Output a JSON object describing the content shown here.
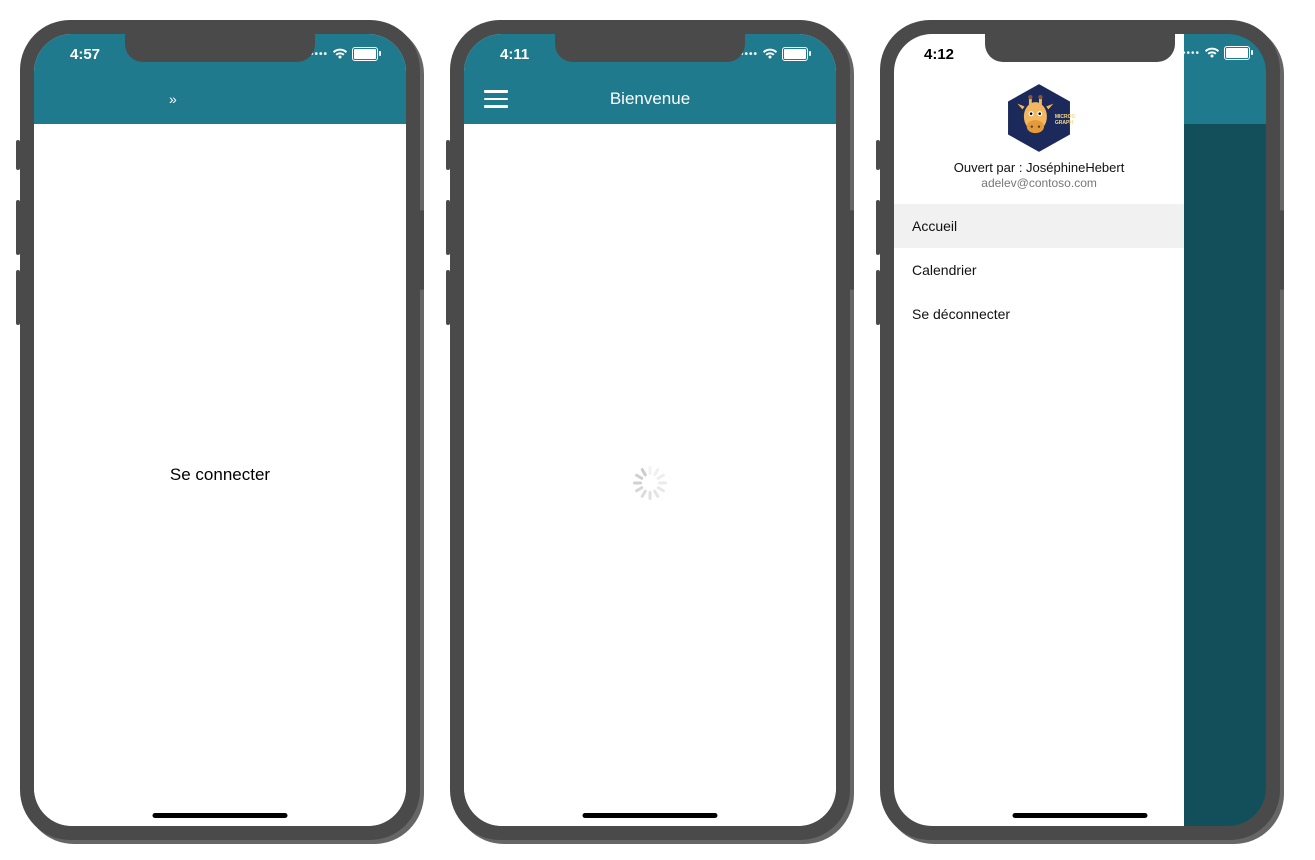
{
  "colors": {
    "teal": "#1e7a8c"
  },
  "phone1": {
    "time": "4:57",
    "signin_label": "Se connecter",
    "nav_glyph": "»"
  },
  "phone2": {
    "time": "4:11",
    "title": "Bienvenue"
  },
  "phone3": {
    "time": "4:12",
    "user_prefix": "Ouvert par : ",
    "user_name": "JoséphineHebert",
    "user_email": "adelev@contoso.com",
    "avatar_label": "Microsoft Graph",
    "menu": {
      "home": "Accueil",
      "calendar": "Calendrier",
      "signout": "Se déconnecter"
    }
  }
}
